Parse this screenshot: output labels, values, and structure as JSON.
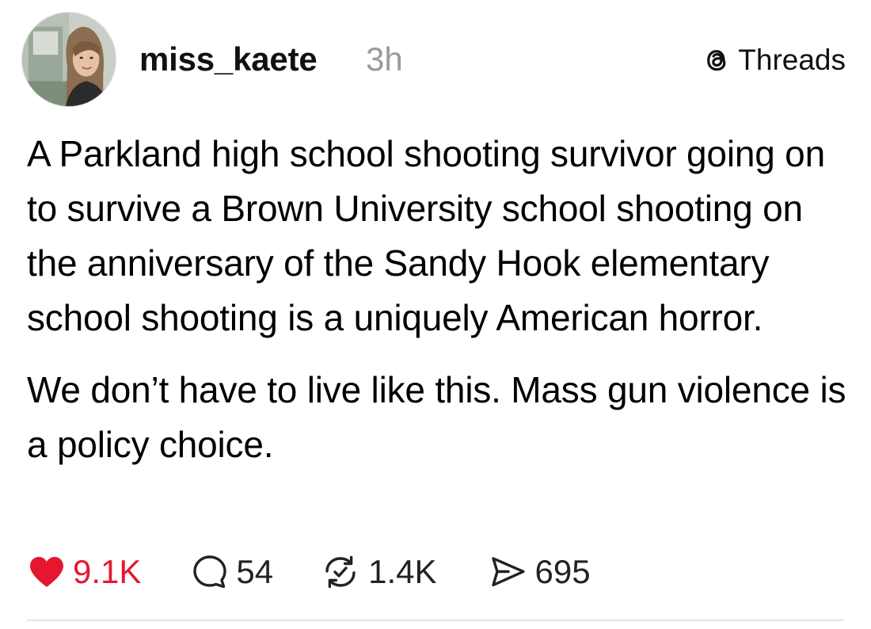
{
  "post": {
    "author": {
      "username": "miss_kaete",
      "time": "3h",
      "avatar_icon": "profile-photo"
    },
    "platform": {
      "label": "Threads",
      "icon": "threads-logo-icon"
    },
    "paragraphs": [
      "A Parkland high school shooting survivor going on to survive a Brown University school shooting on the anniversary of the Sandy Hook elementary school shooting is a uniquely American horror.",
      "We don’t have to live like this. Mass gun violence is a policy choice."
    ],
    "actions": {
      "likes": "9.1K",
      "replies": "54",
      "reposts": "1.4K",
      "shares": "695"
    },
    "colors": {
      "like": "#e5172f",
      "text": "#000000",
      "muted": "#9a9a9a"
    }
  }
}
